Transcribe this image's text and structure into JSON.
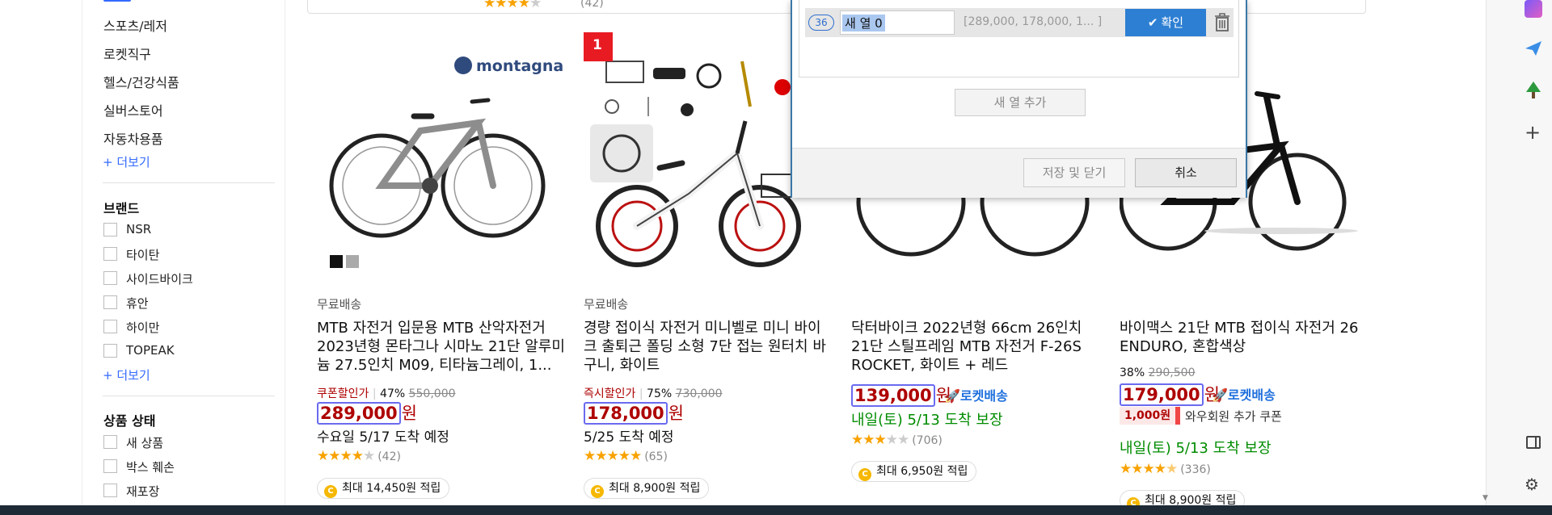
{
  "sidebar": {
    "categories": [
      "스포츠/레저",
      "로켓직구",
      "헬스/건강식품",
      "실버스토어",
      "자동차용품"
    ],
    "more1": "+ 더보기",
    "brand_title": "브랜드",
    "brands": [
      "NSR",
      "타이탄",
      "사이드바이크",
      "휴안",
      "하이만",
      "TOPEAK"
    ],
    "more2": "+ 더보기",
    "state_title": "상품 상태",
    "states": [
      "새 상품",
      "박스 훼손",
      "재포장"
    ]
  },
  "top_remnant": {
    "review_count": "(42)"
  },
  "dialog": {
    "row_index": "36",
    "name_value": "새 열 0",
    "preview": "[289,000, 178,000, 1... ]",
    "confirm": "확인",
    "add_column": "새 열 추가",
    "save_close": "저장 및 닫기",
    "cancel": "취소"
  },
  "products": [
    {
      "badge": "",
      "brand_logo": "montagna",
      "free_ship": "무료배송",
      "title": "MTB 자전거 입문용 MTB 산악자전거 2023년형 몬타그나 시마노 21단 알루미늄 27.5인치 M09, 티타늄그레이, 1...",
      "discount_label": "쿠폰할인가",
      "discount_pct": "47%",
      "original_price": "550,000",
      "price": "289,000",
      "won": "원",
      "delivery": "수요일 5/17 도착 예정",
      "rating": 4,
      "reviews": "(42)",
      "cashback": "최대 14,450원 적립"
    },
    {
      "badge": "1",
      "free_ship": "무료배송",
      "title": "경량 접이식 자전거 미니벨로 미니 바이크 출퇴근 폴딩 소형 7단 접는 원터치 바구니, 화이트",
      "discount_label": "즉시할인가",
      "discount_pct": "75%",
      "original_price": "730,000",
      "price": "178,000",
      "won": "원",
      "delivery": "5/25 도착 예정",
      "rating": 5,
      "reviews": "(65)",
      "cashback": "최대 8,900원 적립"
    },
    {
      "title": "닥터바이크 2022년형 66cm 26인치 21단 스틸프레임 MTB 자전거 F-26S ROCKET, 화이트 + 레드",
      "price": "139,000",
      "won": "원",
      "rocket": "로켓배송",
      "delivery": "내일(토) 5/13 도착 보장",
      "rating": 3,
      "reviews": "(706)",
      "cashback": "최대 6,950원 적립"
    },
    {
      "title": "바이맥스 21단 MTB 접이식 자전거 26 ENDURO, 혼합색상",
      "discount_pct": "38%",
      "original_price": "290,500",
      "price": "179,000",
      "won": "원",
      "rocket": "로켓배송",
      "coupon": "1,000원",
      "coupon_text": "와우회원 추가 쿠폰",
      "delivery": "내일(토) 5/13 도착 보장",
      "rating": 4.5,
      "reviews": "(336)",
      "cashback": "최대 8,900원 적립"
    }
  ],
  "colors": {
    "accent": "#346aff",
    "price": "#ae0000",
    "green": "#008c00",
    "star": "#f8a200",
    "dialog_btn": "#2d7fd3"
  }
}
